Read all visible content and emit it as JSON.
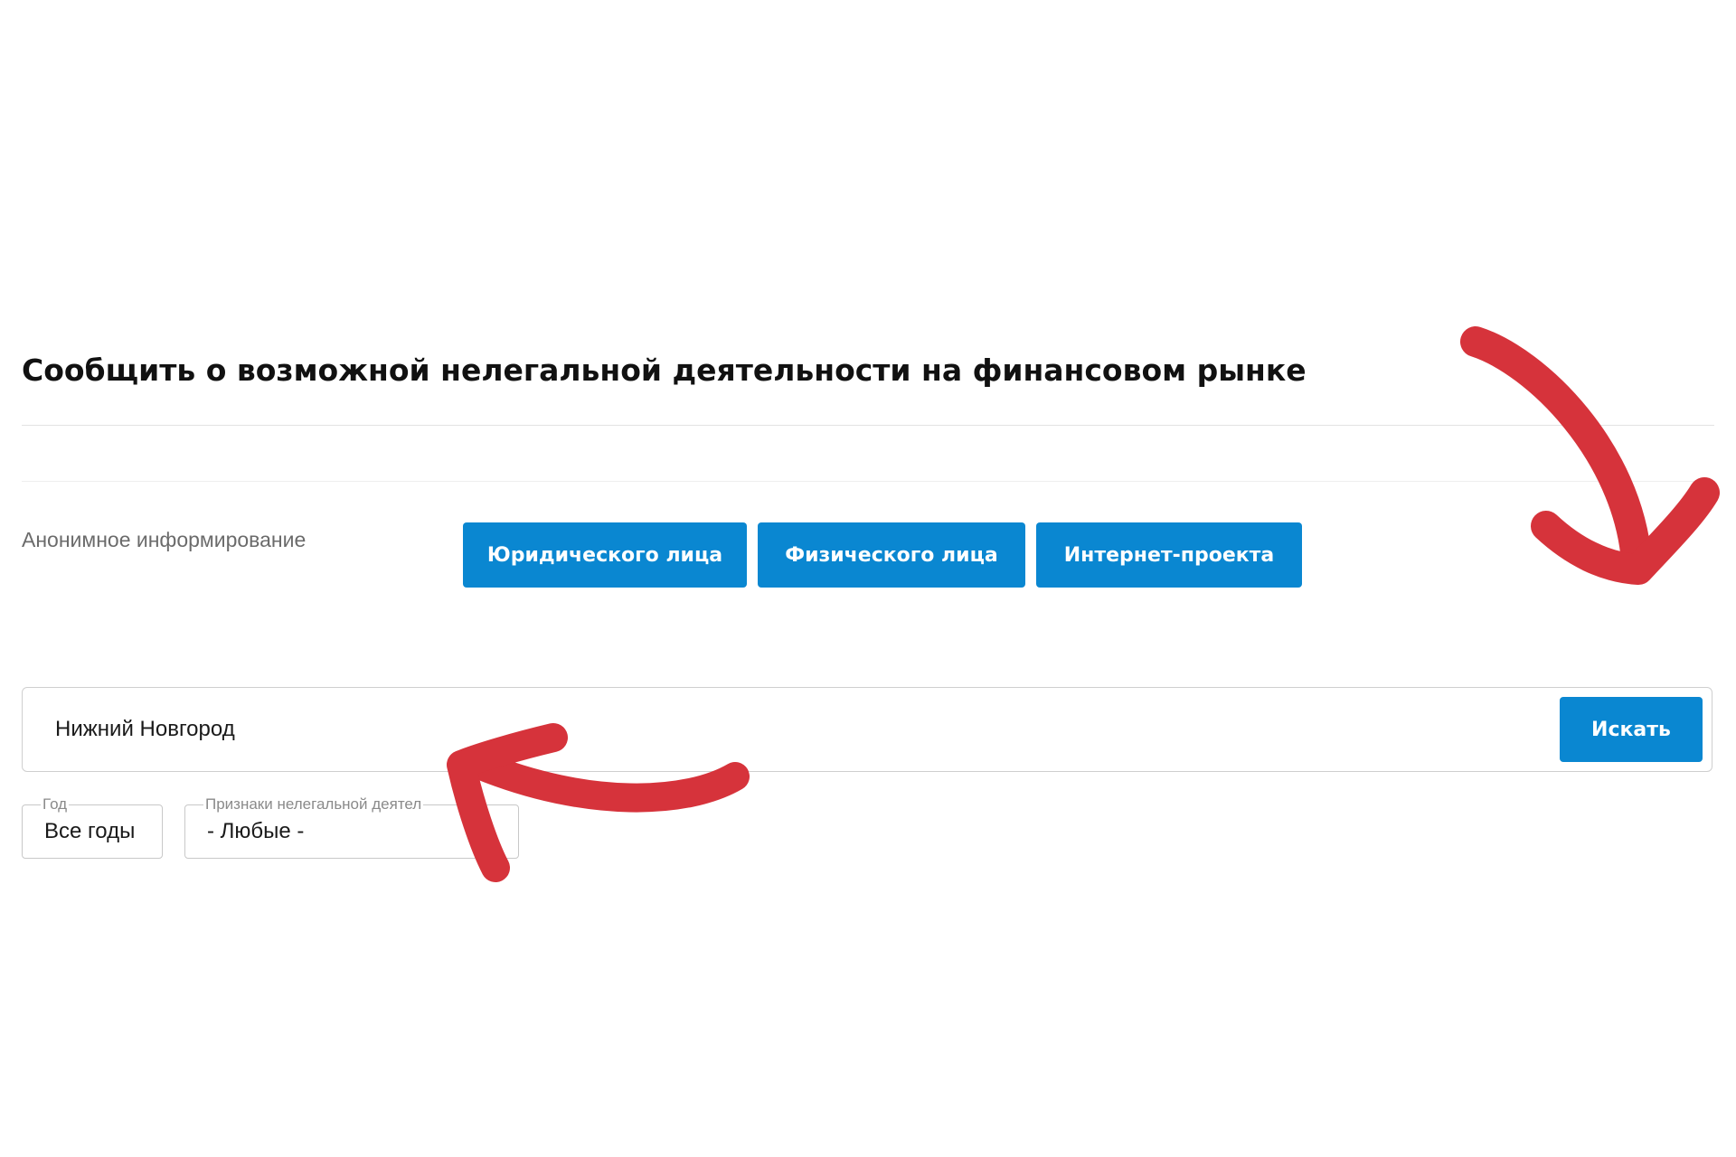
{
  "header": {
    "title": "Сообщить о возможной нелегальной деятельности на финансовом рынке"
  },
  "anonymous": {
    "label": "Анонимное информирование",
    "buttons": [
      {
        "label": "Юридического лица"
      },
      {
        "label": "Физического лица"
      },
      {
        "label": "Интернет-проекта"
      }
    ]
  },
  "search": {
    "value": "Нижний Новгород",
    "button_label": "Искать"
  },
  "filters": {
    "year": {
      "legend": "Год",
      "value": "Все годы"
    },
    "signs": {
      "legend": "Признаки нелегальной деятел",
      "value": "- Любые -"
    }
  },
  "theme": {
    "accent": "#0a87d1",
    "annotation": "#d6333b"
  }
}
